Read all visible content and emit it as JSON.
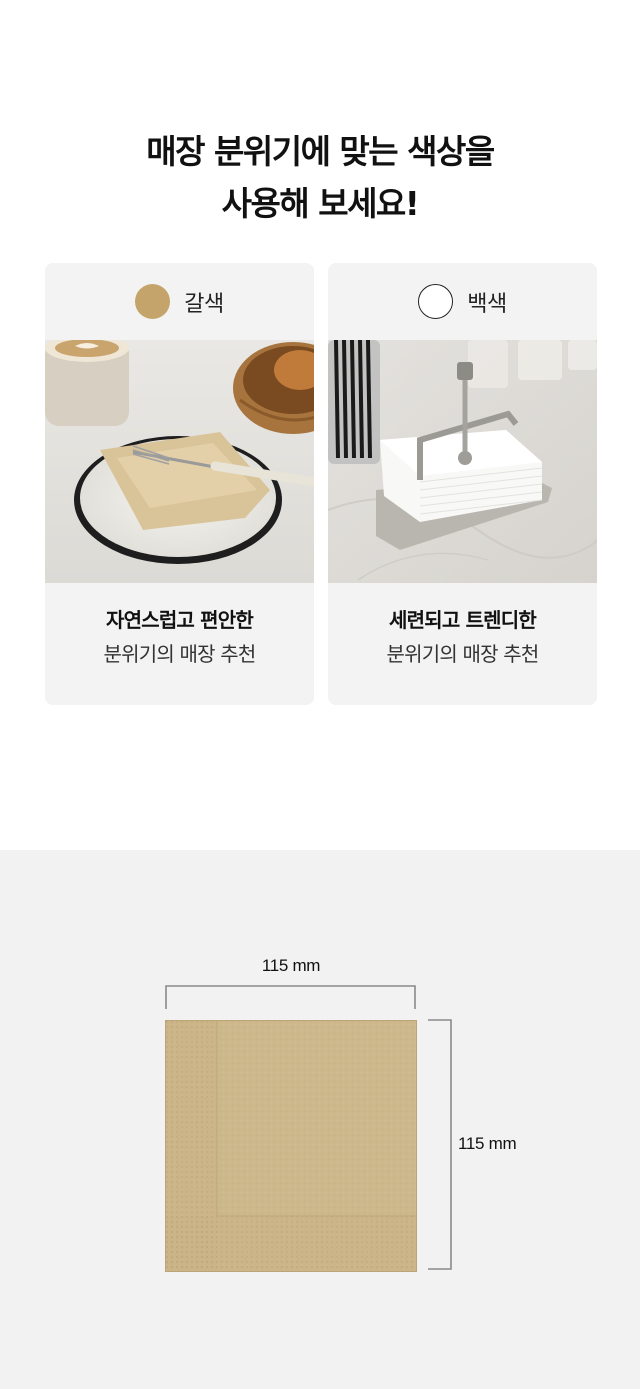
{
  "headline": {
    "line1": "매장 분위기에 맞는 색상을",
    "line2": "사용해 보세요!"
  },
  "options": [
    {
      "color_name": "갈색",
      "swatch_color": "#c4a46b",
      "desc_strong": "자연스럽고 편안한",
      "desc_normal": "분위기의 매장 추천"
    },
    {
      "color_name": "백색",
      "swatch_color": "#ffffff",
      "desc_strong": "세련되고 트렌디한",
      "desc_normal": "분위기의 매장 추천"
    }
  ],
  "dimensions": {
    "width_label": "115 mm",
    "height_label": "115 mm"
  }
}
